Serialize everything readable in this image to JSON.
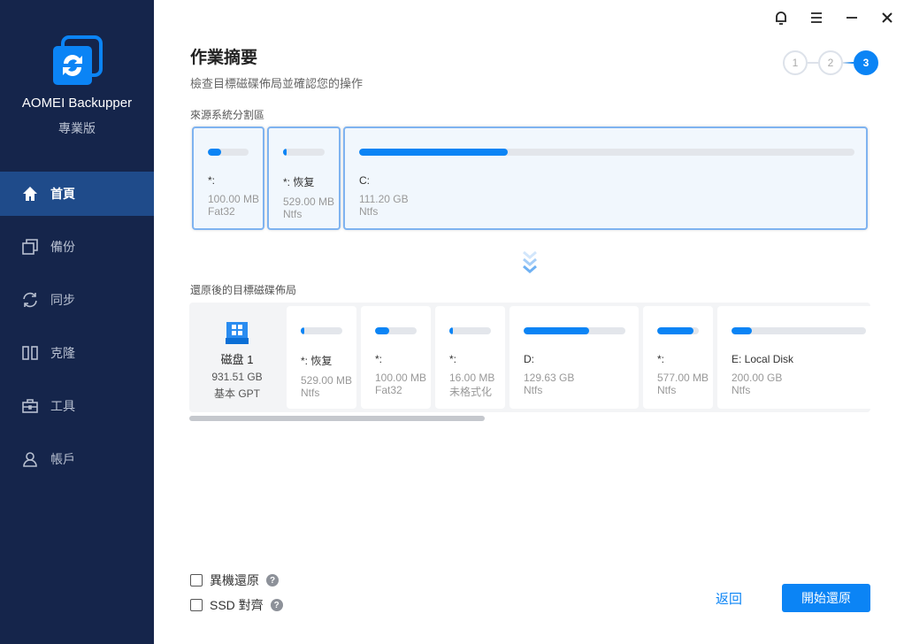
{
  "app": {
    "name": "AOMEI Backupper",
    "edition": "專業版"
  },
  "nav": [
    {
      "label": "首頁",
      "icon": "home-icon"
    },
    {
      "label": "備份",
      "icon": "backup-icon"
    },
    {
      "label": "同步",
      "icon": "sync-icon"
    },
    {
      "label": "克隆",
      "icon": "clone-icon"
    },
    {
      "label": "工具",
      "icon": "tools-icon"
    },
    {
      "label": "帳戶",
      "icon": "account-icon"
    }
  ],
  "header": {
    "title": "作業摘要",
    "subtitle": "檢查目標磁碟佈局並確認您的操作"
  },
  "steps": [
    "1",
    "2",
    "3"
  ],
  "active_step": 3,
  "source": {
    "label": "來源系統分割區",
    "partitions": [
      {
        "name": "*:",
        "size": "100.00 MB",
        "fs": "Fat32",
        "used": 0.33
      },
      {
        "name": "*: 恢复",
        "size": "529.00 MB",
        "fs": "Ntfs",
        "used": 0.08
      },
      {
        "name": "C:",
        "size": "111.20 GB",
        "fs": "Ntfs",
        "used": 0.3
      }
    ]
  },
  "target": {
    "label": "還原後的目標磁碟佈局",
    "disk": {
      "name": "磁盘 1",
      "size": "931.51 GB",
      "type": "基本 GPT"
    },
    "partitions": [
      {
        "name": "*: 恢复",
        "size": "529.00 MB",
        "fs": "Ntfs",
        "used": 0.08
      },
      {
        "name": "*:",
        "size": "100.00 MB",
        "fs": "Fat32",
        "used": 0.33
      },
      {
        "name": "*:",
        "size": "16.00 MB",
        "fs": "未格式化",
        "used": 0.08
      },
      {
        "name": "D:",
        "size": "129.63 GB",
        "fs": "Ntfs",
        "used": 0.64
      },
      {
        "name": "*:",
        "size": "577.00 MB",
        "fs": "Ntfs",
        "used": 0.87
      },
      {
        "name": "E: Local Disk",
        "size": "200.00 GB",
        "fs": "Ntfs",
        "used": 0.15
      }
    ]
  },
  "options": {
    "universal_restore": "異機還原",
    "ssd_align": "SSD 對齊",
    "help": "?"
  },
  "buttons": {
    "back": "返回",
    "start": "開始還原"
  },
  "colors": {
    "accent": "#0b84f5",
    "sidebar": "#15254b"
  }
}
